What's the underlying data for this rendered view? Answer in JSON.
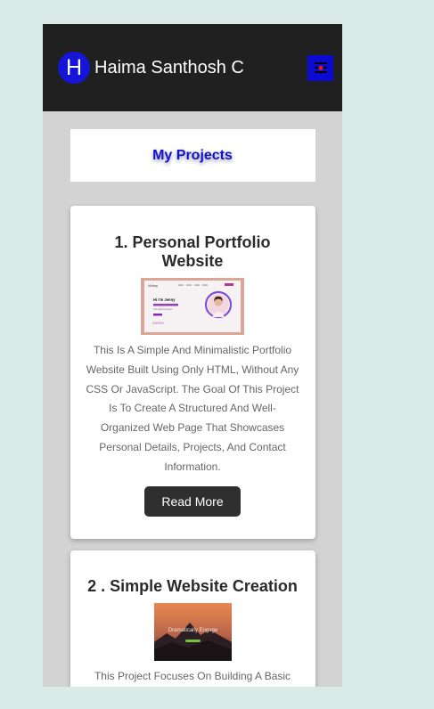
{
  "header": {
    "logo_letter": "H",
    "brand_name": "Haima Santhosh C",
    "menu_icon": "menu-icon"
  },
  "projects_heading": "My Projects",
  "projects": [
    {
      "title": "1. Personal Portfolio Website",
      "thumb_text": {
        "brand": "Victory",
        "heading": "Hi I'm Jenny",
        "sub": "Full-stack developer",
        "tag": "SIGRO"
      },
      "description": "This Is A Simple And Minimalistic Portfolio Website Built Using Only HTML, Without Any CSS Or JavaScript. The Goal Of This Project Is To Create A Structured And Well-Organized Web Page That Showcases Personal Details, Projects, And Contact Information.",
      "button_label": "Read More"
    },
    {
      "title": "2 . Simple Website Creation",
      "thumb_text": {
        "caption": "Dramatically Engage"
      },
      "description": "This Project Focuses On Building A Basic"
    }
  ],
  "colors": {
    "page_bg": "#d9eae8",
    "phone_bg": "#d3d3d3",
    "navbar_bg": "#202020",
    "accent_blue": "#1515d8",
    "button_bg": "#2f2f2f"
  }
}
